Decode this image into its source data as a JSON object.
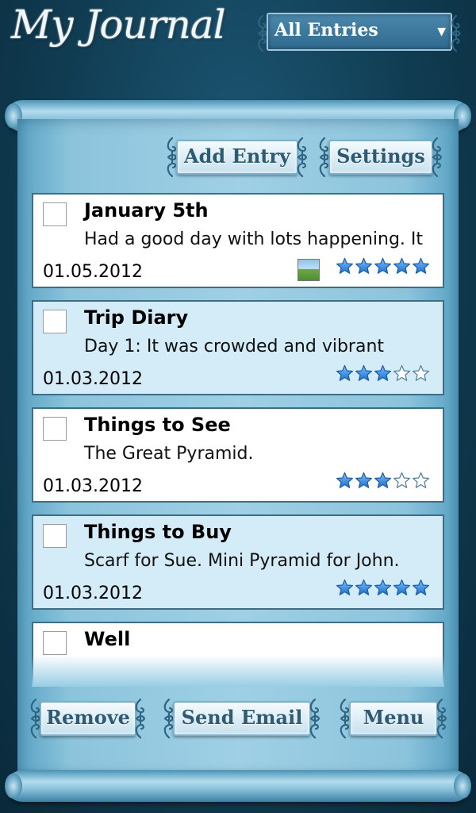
{
  "header": {
    "app_title": "My Journal",
    "filter": {
      "selected": "All Entries"
    }
  },
  "toolbar": {
    "add_entry_label": "Add Entry",
    "settings_label": "Settings"
  },
  "entries": [
    {
      "title": "January 5th",
      "preview": "Had a good day with lots happening. It",
      "date": "01.05.2012",
      "rating": 5,
      "has_photo": true
    },
    {
      "title": "Trip Diary",
      "preview": "Day 1: It was crowded and vibrant",
      "date": "01.03.2012",
      "rating": 3,
      "has_photo": false
    },
    {
      "title": "Things to See",
      "preview": "The Great Pyramid.",
      "date": "01.03.2012",
      "rating": 3,
      "has_photo": false
    },
    {
      "title": "Things to Buy",
      "preview": "Scarf for Sue. Mini Pyramid for John.",
      "date": "01.03.2012",
      "rating": 5,
      "has_photo": false
    },
    {
      "title": "Well",
      "preview": "",
      "date": "",
      "rating": 0,
      "has_photo": false
    }
  ],
  "bottom_bar": {
    "remove_label": "Remove",
    "send_email_label": "Send Email",
    "menu_label": "Menu"
  },
  "colors": {
    "background": "#103c52",
    "scroll": "#9fd0e5",
    "row_alt": "#d3ecf7",
    "star_fill": "#3f8fe0",
    "button_text": "#2e5a74"
  },
  "icons": {
    "dropdown": "chevron-down-icon",
    "rating": "star-icon",
    "photo": "photo-thumbnail-icon"
  }
}
